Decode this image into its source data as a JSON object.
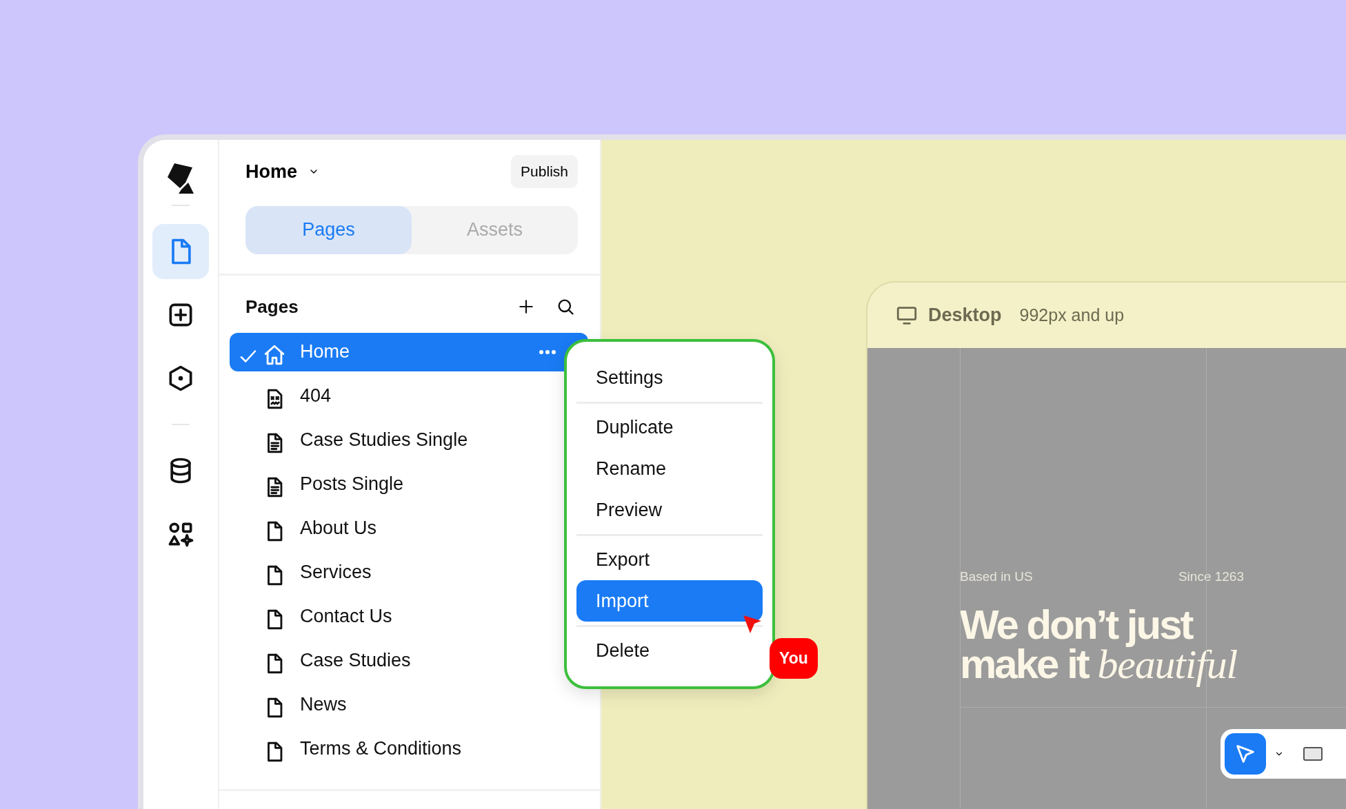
{
  "rail": {
    "items": [
      {
        "selected": true
      },
      {
        "selected": false
      },
      {
        "selected": false
      },
      {
        "selected": false
      },
      {
        "selected": false
      }
    ]
  },
  "panel": {
    "title": "Home",
    "publish": "Publish",
    "tabs": [
      {
        "label": "Pages",
        "selected": true
      },
      {
        "label": "Assets",
        "selected": false
      }
    ],
    "section_title": "Pages",
    "pages": [
      {
        "label": "Home",
        "kind": "home",
        "selected": true
      },
      {
        "label": "404",
        "kind": "error",
        "selected": false
      },
      {
        "label": "Case Studies Single",
        "kind": "template",
        "selected": false
      },
      {
        "label": "Posts Single",
        "kind": "template",
        "selected": false
      },
      {
        "label": "About Us",
        "kind": "page",
        "selected": false
      },
      {
        "label": "Services",
        "kind": "page",
        "selected": false
      },
      {
        "label": "Contact Us",
        "kind": "page",
        "selected": false
      },
      {
        "label": "Case Studies",
        "kind": "page",
        "selected": false
      },
      {
        "label": "News",
        "kind": "page",
        "selected": false
      },
      {
        "label": "Terms & Conditions",
        "kind": "page",
        "selected": false
      }
    ]
  },
  "context_menu": {
    "groups": [
      [
        {
          "label": "Settings",
          "selected": false
        }
      ],
      [
        {
          "label": "Duplicate",
          "selected": false
        },
        {
          "label": "Rename",
          "selected": false
        },
        {
          "label": "Preview",
          "selected": false
        }
      ],
      [
        {
          "label": "Export",
          "selected": false
        },
        {
          "label": "Import",
          "selected": true
        }
      ],
      [
        {
          "label": "Delete",
          "selected": false
        }
      ]
    ]
  },
  "cursor": {
    "label": "You"
  },
  "canvas": {
    "breakpoint": {
      "name": "Desktop",
      "range": "992px and up"
    },
    "artboard": {
      "eyebrow_left": "Based in US",
      "eyebrow_right": "Since 1263",
      "headline_lines": [
        "We don’t just",
        "make it *beautiful*"
      ]
    }
  },
  "toolbar": {
    "tools": [
      {
        "kind": "pointer",
        "selected": true
      },
      {
        "kind": "frame",
        "selected": false
      }
    ]
  }
}
